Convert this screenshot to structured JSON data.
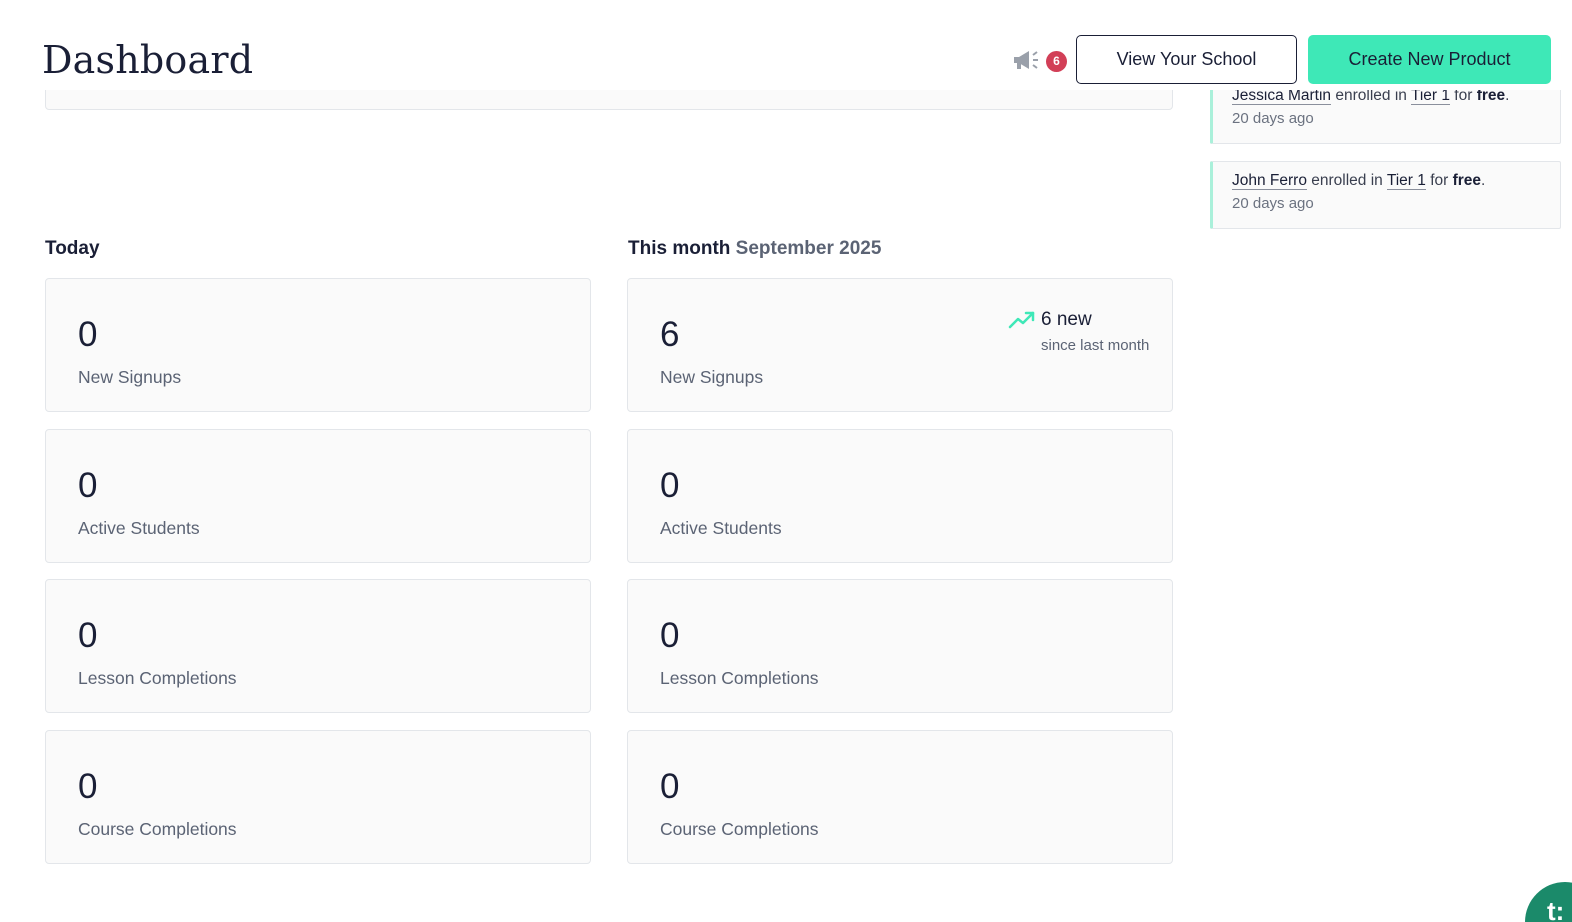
{
  "header": {
    "title": "Dashboard",
    "announcements_count": "6",
    "announce_icon": "megaphone-icon",
    "view_school_label": "View Your School",
    "create_product_label": "Create New Product"
  },
  "activity": [
    {
      "name": "Jessica Martin",
      "action": "enrolled in",
      "item": "Tier 1",
      "connector": "for",
      "price": "free",
      "time": "20 days ago"
    },
    {
      "name": "John Ferro",
      "action": "enrolled in",
      "item": "Tier 1",
      "connector": "for",
      "price": "free",
      "time": "20 days ago"
    }
  ],
  "today": {
    "heading": "Today",
    "stats": [
      {
        "value": "0",
        "label": "New Signups"
      },
      {
        "value": "0",
        "label": "Active Students"
      },
      {
        "value": "0",
        "label": "Lesson Completions"
      },
      {
        "value": "0",
        "label": "Course Completions"
      }
    ]
  },
  "month": {
    "heading": "This month",
    "period": "September 2025",
    "stats": [
      {
        "value": "6",
        "label": "New Signups",
        "trend": {
          "value": "6 new",
          "sub": "since last month",
          "icon": "trending-up-icon"
        }
      },
      {
        "value": "0",
        "label": "Active Students"
      },
      {
        "value": "0",
        "label": "Lesson Completions"
      },
      {
        "value": "0",
        "label": "Course Completions"
      }
    ]
  },
  "fab": {
    "glyph": "t:"
  },
  "colors": {
    "accent": "#3ee8b7",
    "badge": "#d23f57",
    "activity_border": "#aaf0da",
    "trend_icon": "#3ee8b7",
    "fab": "#1b8a6a"
  }
}
